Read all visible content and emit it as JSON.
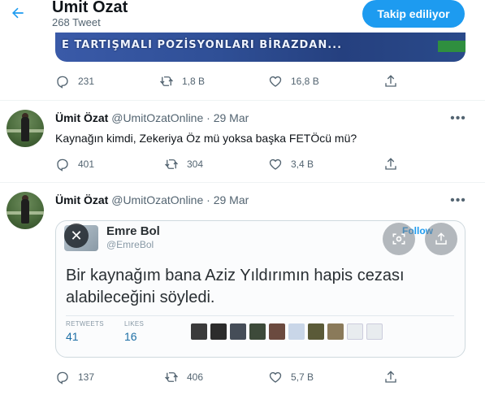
{
  "header": {
    "title": "Ümit Özat",
    "tweet_count": "268 Tweet",
    "follow_button": "Takip ediliyor"
  },
  "banner": {
    "text": "E TARTIŞMALI POZİSYONLARI BİRAZDAN..."
  },
  "tweets": [
    {
      "replies": "231",
      "retweets": "1,8 B",
      "likes": "16,8 B"
    },
    {
      "name": "Ümit Özat",
      "handle": "@UmitOzatOnline",
      "date": "· 29 Mar",
      "text": "Kaynağın kimdi, Zekeriya Öz mü yoksa başka FETÖcü mü?",
      "replies": "401",
      "retweets": "304",
      "likes": "3,4 B"
    },
    {
      "name": "Ümit Özat",
      "handle": "@UmitOzatOnline",
      "date": "· 29 Mar",
      "replies": "137",
      "retweets": "406",
      "likes": "5,7 B",
      "embed": {
        "name": "Emre Bol",
        "handle": "@EmreBol",
        "follow": "Follow",
        "text": "Bir kaynağım bana Aziz Yıldırımın hapis cezası alabileceğini söyledi.",
        "retweets_label": "RETWEETS",
        "retweets_value": "41",
        "likes_label": "LIKES",
        "likes_value": "16"
      }
    }
  ],
  "icons": {
    "back": "back-arrow-icon",
    "reply": "reply-icon",
    "retweet": "retweet-icon",
    "like": "heart-icon",
    "share": "share-icon",
    "more": "more-icon"
  },
  "colors": {
    "accent": "#1d9bf0",
    "secondary_text": "#536471"
  }
}
